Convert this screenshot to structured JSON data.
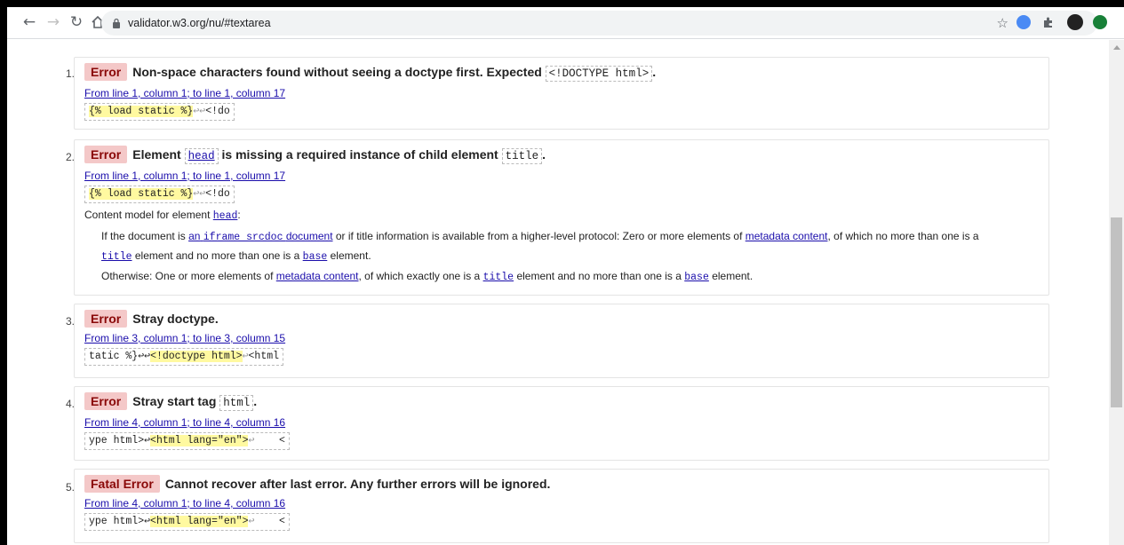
{
  "browser": {
    "url": "validator.w3.org/nu/#textarea",
    "ext_colors": [
      "#4a8af4",
      "#5f6368",
      "#222222",
      "#188038"
    ]
  },
  "messages": [
    {
      "num": "1.",
      "type": "Error",
      "parts": [
        "Non-space characters found without seeing a doctype first. Expected",
        "<!DOCTYPE html>",
        "."
      ],
      "location": "From line 1, column 1; to line 1, column 17",
      "extract": {
        "before": "",
        "highlight": "{% load static %}",
        "returns": "↩↩",
        "after": "<!do"
      }
    },
    {
      "num": "2.",
      "type": "Error",
      "parts": [
        "Element",
        "head",
        "is missing a required instance of child element",
        "title",
        "."
      ],
      "location": "From line 1, column 1; to line 1, column 17",
      "extract": {
        "before": "",
        "highlight": "{% load static %}",
        "returns": "↩↩",
        "after": "<!do"
      },
      "details": {
        "intro": "Content model for element",
        "intro_code": "head",
        "intro_end": ":",
        "p1_a": "If the document is",
        "p1_link_code1": "an",
        "p1_link_mono": "iframe srcdoc",
        "p1_link_tail": "document",
        "p1_b": "or if title information is available from a higher-level protocol: Zero or more elements of",
        "p1_link2": "metadata content",
        "p1_c": ", of which no more than one is a",
        "p1_code_title": "title",
        "p1_d": "element and no more than one is a",
        "p1_code_base": "base",
        "p1_e": "element.",
        "p2_a": "Otherwise: One or more elements of",
        "p2_link": "metadata content",
        "p2_b": ", of which exactly one is a",
        "p2_code_title": "title",
        "p2_c": "element and no more than one is a",
        "p2_code_base": "base",
        "p2_d": "element."
      }
    },
    {
      "num": "3.",
      "type": "Error",
      "parts": [
        "Stray doctype."
      ],
      "location": "From line 3, column 1; to line 3, column 15",
      "extract": {
        "before": "tatic %}↩↩",
        "highlight": "<!doctype html>",
        "returns": "↩",
        "after": "<html"
      }
    },
    {
      "num": "4.",
      "type": "Error",
      "parts": [
        "Stray start tag",
        "html",
        "."
      ],
      "location": "From line 4, column 1; to line 4, column 16",
      "extract": {
        "before": "ype html>↩",
        "highlight": "<html lang=\"en\">",
        "returns": "↩",
        "after": "    <"
      }
    },
    {
      "num": "5.",
      "type": "Fatal Error",
      "parts": [
        "Cannot recover after last error. Any further errors will be ignored."
      ],
      "location": "From line 4, column 1; to line 4, column 16",
      "extract": {
        "before": "ype html>↩",
        "highlight": "<html lang=\"en\">",
        "returns": "↩",
        "after": "    <"
      }
    }
  ]
}
